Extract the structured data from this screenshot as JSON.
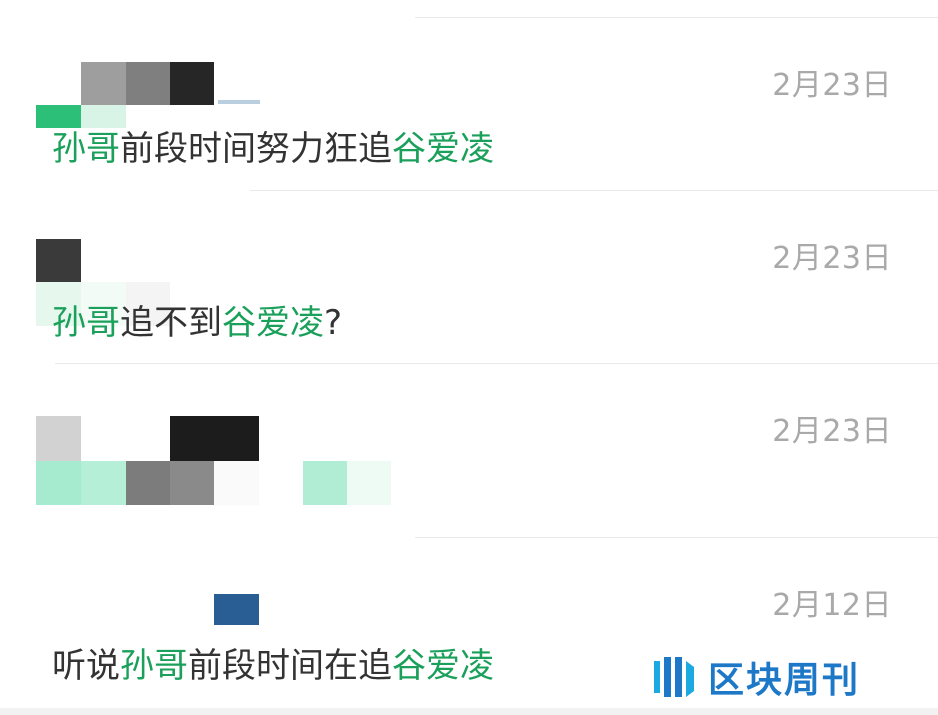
{
  "results": [
    {
      "date": "2月23日",
      "snippet": [
        {
          "text": "孙哥",
          "highlight": true
        },
        {
          "text": "前段时间努力狂追",
          "highlight": false
        },
        {
          "text": "谷爱凌",
          "highlight": true
        }
      ]
    },
    {
      "date": "2月23日",
      "snippet": [
        {
          "text": "孙哥",
          "highlight": true
        },
        {
          "text": "追不到",
          "highlight": false
        },
        {
          "text": "谷爱凌",
          "highlight": true
        },
        {
          "text": "?",
          "highlight": false
        }
      ]
    },
    {
      "date": "2月23日",
      "snippet": []
    },
    {
      "date": "2月12日",
      "snippet": [
        {
          "text": "听说",
          "highlight": false
        },
        {
          "text": "孙哥",
          "highlight": true
        },
        {
          "text": "前段时间在追",
          "highlight": false
        },
        {
          "text": "谷爱凌",
          "highlight": true
        }
      ]
    }
  ],
  "watermark": {
    "text": "区块周刊",
    "color": "#1d78c8"
  },
  "colors": {
    "highlight": "#1aa05a",
    "date": "#a9a9a9",
    "text": "#333333"
  }
}
